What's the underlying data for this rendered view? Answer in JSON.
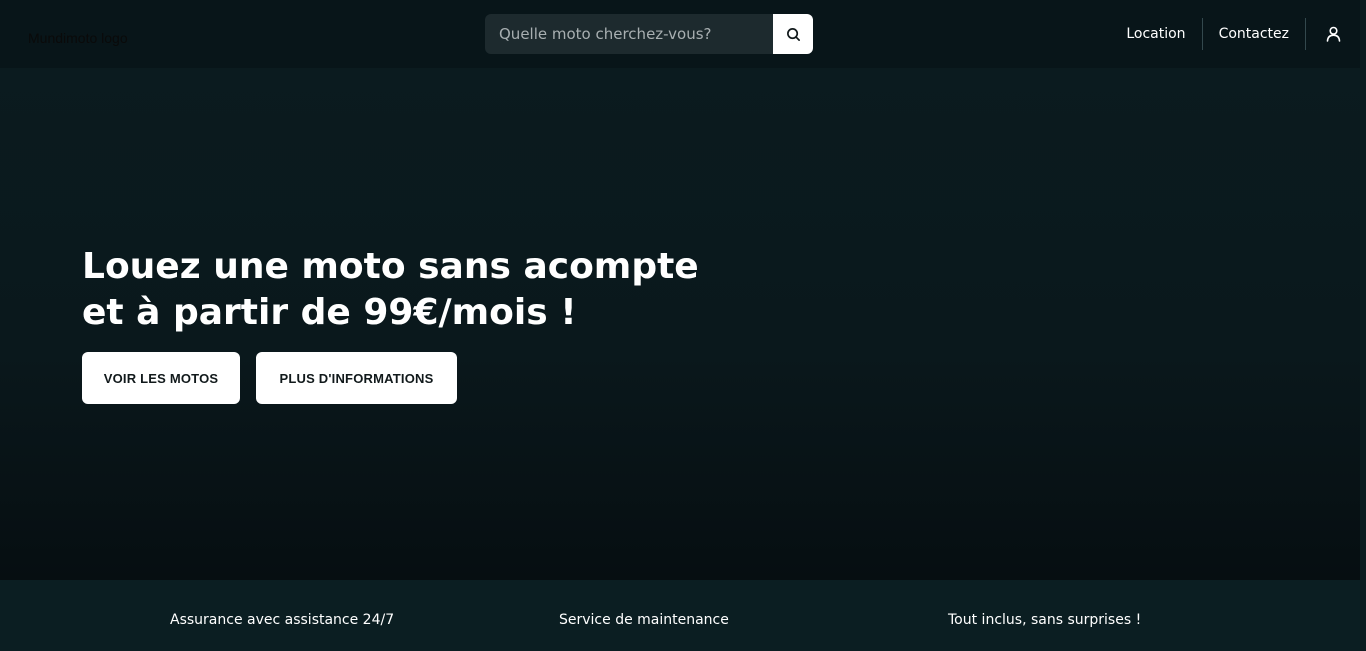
{
  "header": {
    "logo_alt": "Mundimoto logo",
    "search": {
      "placeholder": "Quelle moto cherchez-vous?",
      "value": "",
      "icon": "search-icon"
    },
    "nav": [
      {
        "label": "Location"
      },
      {
        "label": "Contactez"
      }
    ],
    "user_icon": "user-icon"
  },
  "hero": {
    "title_line1": "Louez une moto sans acompte",
    "title_line2": "et à partir de 99€/mois !",
    "buttons": {
      "primary": "VOIR LES MOTOS",
      "secondary": "PLUS D'INFORMATIONS"
    }
  },
  "features": [
    {
      "label": "Assurance avec assistance 24/7"
    },
    {
      "label": "Service de maintenance"
    },
    {
      "label": "Tout inclus, sans surprises !"
    }
  ],
  "colors": {
    "header_bg": "#081519",
    "hero_bg": "#0b1b1f",
    "features_bg": "#0b1e22",
    "button_bg": "#ffffff",
    "button_text": "#11191b",
    "search_bg": "#1d2a2e"
  }
}
